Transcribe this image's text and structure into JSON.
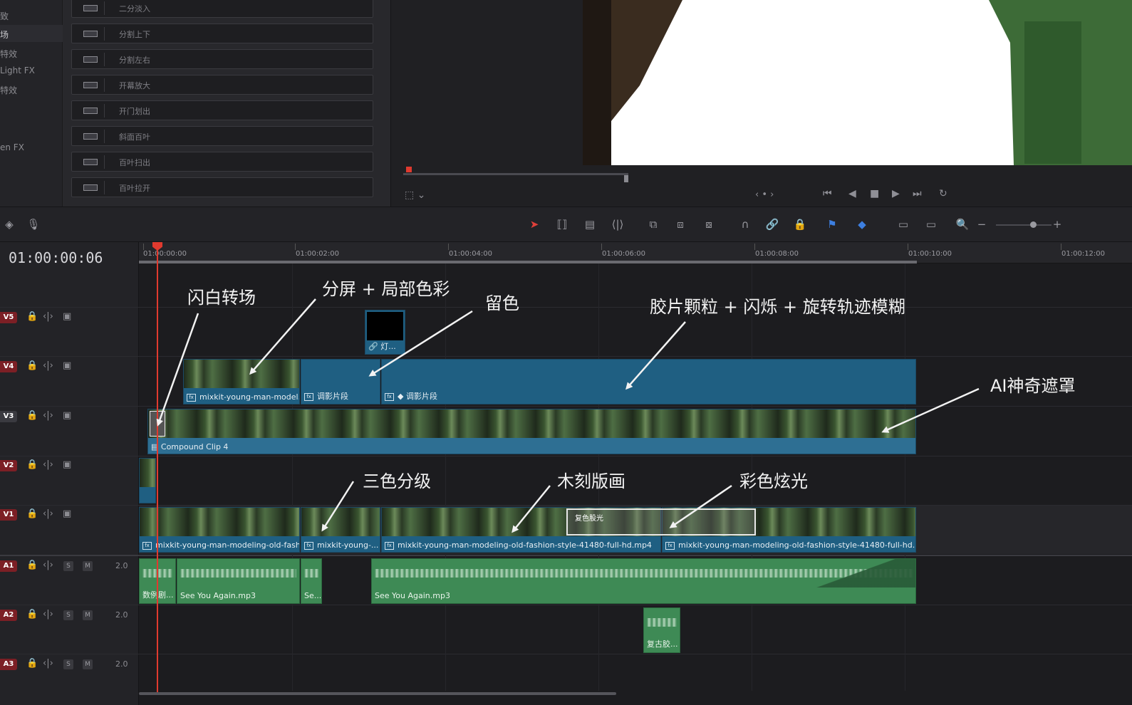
{
  "effects_library": {
    "categories": [
      "致",
      "场",
      "特效",
      "Light FX",
      "特效",
      "en FX"
    ],
    "transitions": [
      {
        "label": "二分淡入",
        "icon": "split-fade-icon"
      },
      {
        "label": "分割上下",
        "icon": "split-vertical-icon"
      },
      {
        "label": "分割左右",
        "icon": "split-horizontal-icon"
      },
      {
        "label": "开幕放大",
        "icon": "curtain-zoom-icon"
      },
      {
        "label": "开门划出",
        "icon": "door-wipe-icon"
      },
      {
        "label": "斜面百叶",
        "icon": "diagonal-blinds-icon"
      },
      {
        "label": "百叶扫出",
        "icon": "blinds-sweep-icon"
      },
      {
        "label": "百叶拉开",
        "icon": "blinds-open-icon"
      }
    ]
  },
  "viewer": {
    "nav_indicator": "‹ • ›",
    "transport": [
      "skip-start-icon",
      "step-back-icon",
      "stop-icon",
      "play-icon",
      "skip-end-icon",
      "loop-icon"
    ]
  },
  "timeline": {
    "timecode": "01:00:00:06",
    "ruler_ticks": [
      "01:00:00:00",
      "01:00:02:00",
      "01:00:04:00",
      "01:00:06:00",
      "01:00:08:00",
      "01:00:10:00",
      "01:00:12:00"
    ],
    "video_tracks": [
      "V5",
      "V4",
      "V3",
      "V2",
      "V1"
    ],
    "audio_tracks": [
      {
        "id": "A1",
        "solo": "S",
        "mute": "M",
        "volume": "2.0"
      },
      {
        "id": "A2",
        "solo": "S",
        "mute": "M",
        "volume": "2.0"
      },
      {
        "id": "A3",
        "solo": "S",
        "mute": "M",
        "volume": "2.0"
      }
    ],
    "clips": {
      "v5_small": "灯...",
      "v4_clip1": "mixkit-young-man-model...",
      "v4_clip2": "调影片段",
      "v4_clip3": "调影片段",
      "v3_compound": "Compound Clip 4",
      "v1_clip1": "mixkit-young-man-modeling-old-fash...",
      "v1_clip2": "mixkit-young-...",
      "v1_clip3": "mixkit-young-man-modeling-old-fashion-style-41480-full-hd.mp4",
      "v1_clip4": "mixkit-young-man-modeling-old-fashion-style-41480-full-hd.mp4",
      "v1_overlay": "复色股光",
      "a1_clip1": "数例剧...",
      "a1_clip2": "See You Again.mp3",
      "a1_clip3": "Se...",
      "a1_clip4": "See You Again.mp3",
      "a2_clip1": "复古胶..."
    }
  },
  "annotations": {
    "flash_transition": "闪白转场",
    "split_screen": "分屏 + 局部色彩",
    "color_keep": "留色",
    "film_grain": "胶片颗粒 + 闪烁 + 旋转轨迹模糊",
    "ai_mask": "AI神奇遮罩",
    "three_color": "三色分级",
    "woodcut": "木刻版画",
    "color_glow": "彩色炫光"
  }
}
